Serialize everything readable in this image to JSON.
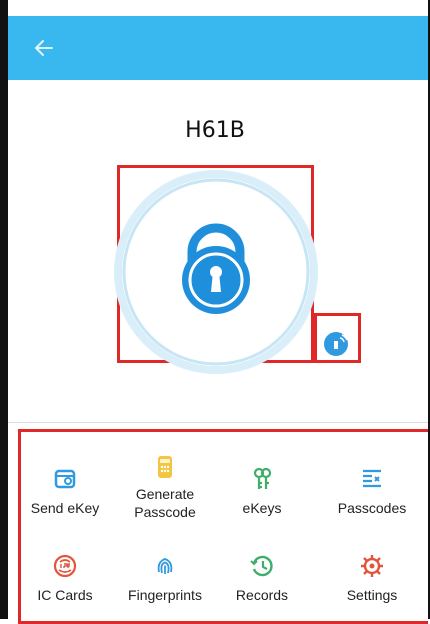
{
  "colors": {
    "header": "#38b8ef",
    "accent": "#1f8fdc",
    "highlight": "#e02828"
  },
  "header": {
    "back_icon": "back-arrow-icon"
  },
  "lock": {
    "name": "H61B",
    "icon": "padlock-icon",
    "remote_icon": "remote-unlock-icon"
  },
  "menu": {
    "items": [
      {
        "label": "Send eKey",
        "icon": "send-ekey-icon"
      },
      {
        "label": "Generate Passcode",
        "label_line1": "Generate",
        "label_line2": "Passcode",
        "icon": "generate-passcode-icon"
      },
      {
        "label": "eKeys",
        "icon": "ekeys-icon"
      },
      {
        "label": "Passcodes",
        "icon": "passcodes-icon"
      },
      {
        "label": "IC Cards",
        "icon": "ic-card-icon"
      },
      {
        "label": "Fingerprints",
        "icon": "fingerprint-icon"
      },
      {
        "label": "Records",
        "icon": "records-icon"
      },
      {
        "label": "Settings",
        "icon": "settings-icon"
      }
    ]
  }
}
